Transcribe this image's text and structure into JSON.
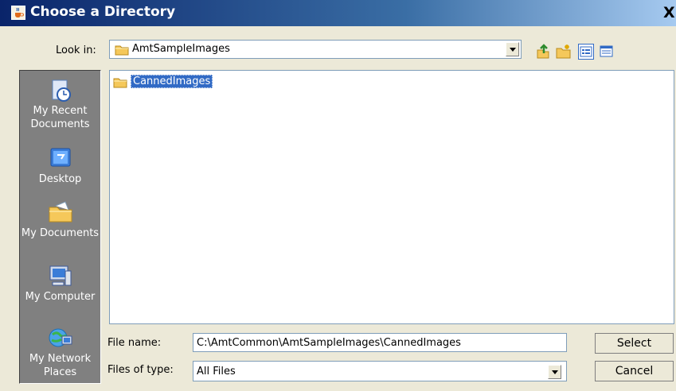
{
  "window": {
    "title": "Choose a Directory",
    "close_glyph": "X"
  },
  "lookin": {
    "label": "Look in:",
    "value": "AmtSampleImages"
  },
  "toolbar": {
    "icons": [
      "up-folder-icon",
      "new-folder-icon",
      "list-view-icon",
      "details-view-icon"
    ]
  },
  "places": [
    {
      "label": "My Recent Documents",
      "icon": "recent-documents-icon"
    },
    {
      "label": "Desktop",
      "icon": "desktop-icon"
    },
    {
      "label": "My Documents",
      "icon": "my-documents-icon"
    },
    {
      "label": "My Computer",
      "icon": "my-computer-icon"
    },
    {
      "label": "My Network Places",
      "icon": "network-places-icon"
    }
  ],
  "files": [
    {
      "name": "CannedImages",
      "type": "folder",
      "selected": true
    }
  ],
  "filename": {
    "label": "File name:",
    "value": "C:\\AmtCommon\\AmtSampleImages\\CannedImages"
  },
  "filetype": {
    "label": "Files of type:",
    "value": "All Files"
  },
  "buttons": {
    "select": "Select",
    "cancel": "Cancel"
  },
  "colors": {
    "selection": "#316ac5",
    "title_gradient_start": "#0a246a",
    "title_gradient_end": "#a6caf0",
    "places_bg": "#808080",
    "dialog_bg": "#ece9d8"
  }
}
